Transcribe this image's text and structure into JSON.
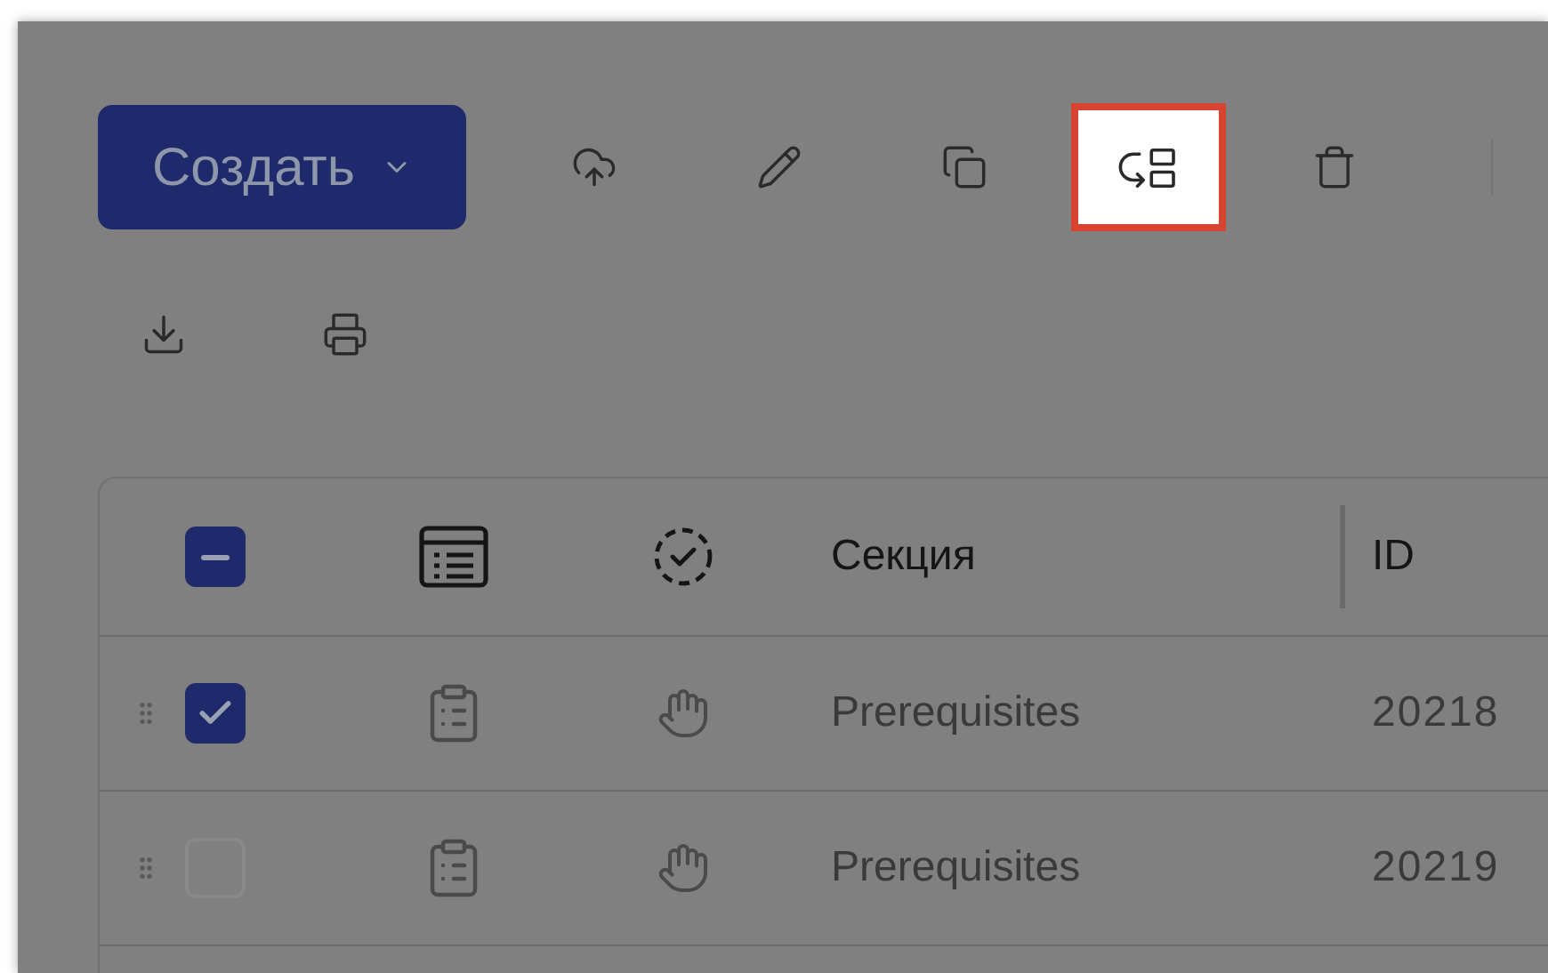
{
  "create_button": {
    "label": "Создать"
  },
  "toolbar": [
    {
      "kind": "upload",
      "highlighted": false
    },
    {
      "kind": "edit",
      "highlighted": false
    },
    {
      "kind": "copy",
      "highlighted": false
    },
    {
      "kind": "move",
      "highlighted": true
    },
    {
      "kind": "delete",
      "highlighted": false
    }
  ],
  "toolbar_row_2": [
    {
      "kind": "download",
      "highlighted": false
    },
    {
      "kind": "print",
      "highlighted": false
    }
  ],
  "table": {
    "header_checkbox": {
      "indeterminate": true
    },
    "columns": [
      "Секция",
      "ID"
    ],
    "rows": [
      {
        "selected": true,
        "section": "Prerequisites",
        "id": "20218"
      },
      {
        "selected": false,
        "section": "Prerequisites",
        "id": "20219"
      }
    ]
  }
}
